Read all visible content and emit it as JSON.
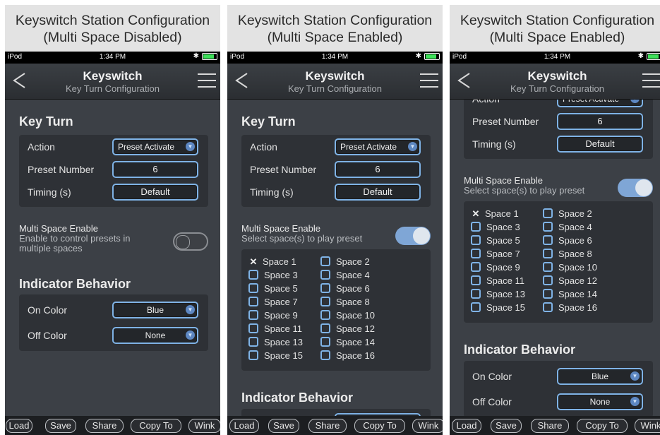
{
  "colors": {
    "accent": "#7fb3e6",
    "toggle_on": "#7fa6d6",
    "panel_bg": "#3c4046",
    "caption_bg": "#e3e3e3"
  },
  "statusbar": {
    "device": "iPod",
    "time": "1:34 PM"
  },
  "navbar": {
    "title": "Keyswitch",
    "subtitle": "Key Turn Configuration"
  },
  "key_turn": {
    "title": "Key Turn",
    "action_label": "Action",
    "action_value": "Preset Activate",
    "preset_label": "Preset Number",
    "preset_value": "6",
    "timing_label": "Timing (s)",
    "timing_value": "Default"
  },
  "multi_space": {
    "label": "Multi Space Enable",
    "disabled_desc_1": "Enable to control presets in",
    "disabled_desc_2": "multiple spaces",
    "enabled_desc": "Select space(s) to play preset",
    "spaces": [
      "Space 1",
      "Space 2",
      "Space 3",
      "Space 4",
      "Space 5",
      "Space 6",
      "Space 7",
      "Space 8",
      "Space 9",
      "Space 10",
      "Space 11",
      "Space 12",
      "Space 13",
      "Space 14",
      "Space 15",
      "Space 16"
    ],
    "selected": "Space 1"
  },
  "indicator": {
    "title": "Indicator Behavior",
    "on_label": "On Color",
    "on_value": "Blue",
    "off_label": "Off Color",
    "off_value": "None"
  },
  "toolbar": {
    "load": "Load",
    "save": "Save",
    "share": "Share",
    "copy_to": "Copy To",
    "wink": "Wink"
  },
  "panels": [
    {
      "caption_1": "Keyswitch Station Configuration",
      "caption_2": "(Multi Space Disabled)",
      "multi_space_enabled": false
    },
    {
      "caption_1": "Keyswitch Station Configuration",
      "caption_2": "(Multi Space Enabled)",
      "multi_space_enabled": true
    },
    {
      "caption_1": "Keyswitch Station Configuration",
      "caption_2": "(Multi Space Enabled)",
      "multi_space_enabled": true
    }
  ]
}
